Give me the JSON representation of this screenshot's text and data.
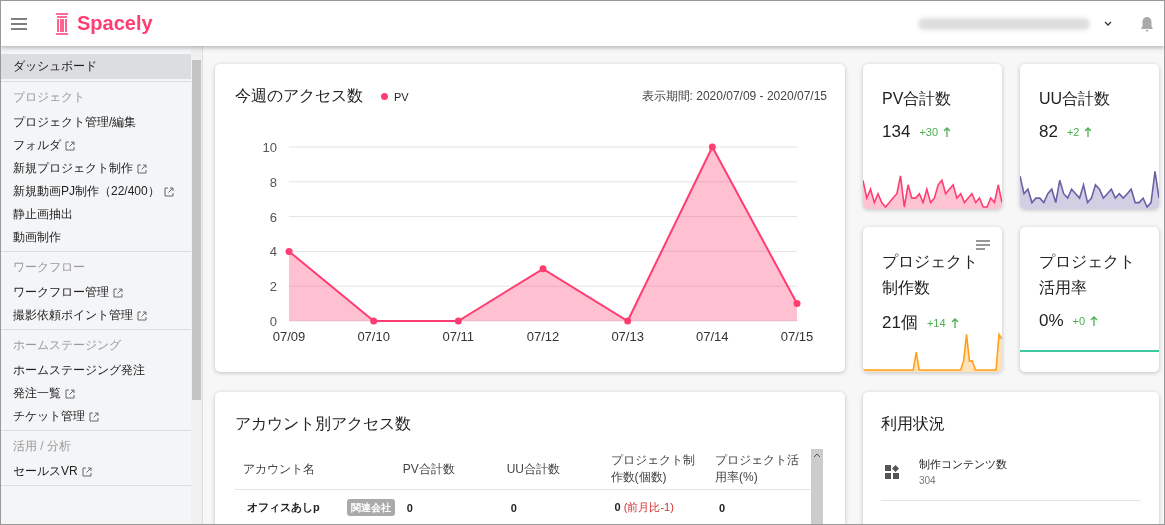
{
  "header": {
    "brand": "Spacely"
  },
  "sidebar": {
    "sections": [
      {
        "items": [
          {
            "label": "ダッシュボード",
            "external": false,
            "selected": true
          }
        ]
      },
      {
        "heading": "プロジェクト",
        "items": [
          {
            "label": "プロジェクト管理/編集",
            "external": false,
            "selected": false
          },
          {
            "label": "フォルダ",
            "external": true,
            "selected": false
          },
          {
            "label": "新規プロジェクト制作",
            "external": true,
            "selected": false
          },
          {
            "label": "新規動画PJ制作（22/400）",
            "external": true,
            "selected": false
          },
          {
            "label": "静止画抽出",
            "external": false,
            "selected": false
          },
          {
            "label": "動画制作",
            "external": false,
            "selected": false
          }
        ]
      },
      {
        "heading": "ワークフロー",
        "items": [
          {
            "label": "ワークフロー管理",
            "external": true,
            "selected": false
          },
          {
            "label": "撮影依頼ポイント管理",
            "external": true,
            "selected": false
          }
        ]
      },
      {
        "heading": "ホームステージング",
        "items": [
          {
            "label": "ホームステージング発注",
            "external": false,
            "selected": false
          },
          {
            "label": "発注一覧",
            "external": true,
            "selected": false
          },
          {
            "label": "チケット管理",
            "external": true,
            "selected": false
          }
        ]
      },
      {
        "heading": "活用 / 分析",
        "items": [
          {
            "label": "セールスVR",
            "external": true,
            "selected": false
          }
        ]
      }
    ]
  },
  "weekly_access": {
    "title": "今週のアクセス数",
    "period": "表示期間: 2020/07/09 - 2020/07/15",
    "chart_data": {
      "type": "area",
      "categories": [
        "07/09",
        "07/10",
        "07/11",
        "07/12",
        "07/13",
        "07/14",
        "07/15"
      ],
      "series": [
        {
          "name": "PV",
          "color": "#ff3d71",
          "values": [
            4,
            0,
            0,
            3,
            0,
            10,
            1
          ]
        }
      ],
      "ylim": [
        0,
        10
      ],
      "grid": true,
      "yticks": [
        0,
        2,
        4,
        6,
        8,
        10
      ]
    }
  },
  "stat_cards": [
    {
      "title": "PV合計数",
      "value": "134",
      "delta": "+30",
      "color": "#ff3d71",
      "menu": false
    },
    {
      "title": "UU合計数",
      "value": "82",
      "delta": "+2",
      "color": "#6b5fa5",
      "menu": false
    },
    {
      "title": "プロジェクト制作数",
      "value": "21個",
      "delta": "+14",
      "color": "#ff9f1a",
      "menu": true
    },
    {
      "title": "プロジェクト活用率",
      "value": "0%",
      "delta": "+0",
      "color": "#3cc8a0",
      "menu": false
    }
  ],
  "account_access": {
    "title": "アカウント別アクセス数",
    "columns": [
      "アカウント名",
      "PV合計数",
      "UU合計数",
      "プロジェクト制作数(個数)",
      "プロジェクト活用率(%)"
    ],
    "rows": [
      {
        "name": "オフィスあしp",
        "tag": "関連会社",
        "pv": "0",
        "uu": "0",
        "projects": "0",
        "projects_change": "(前月比-1)",
        "usage_rate": "0"
      }
    ]
  },
  "usage": {
    "title": "利用状況",
    "items": [
      {
        "label": "制作コンテンツ数",
        "value": "304"
      }
    ]
  }
}
